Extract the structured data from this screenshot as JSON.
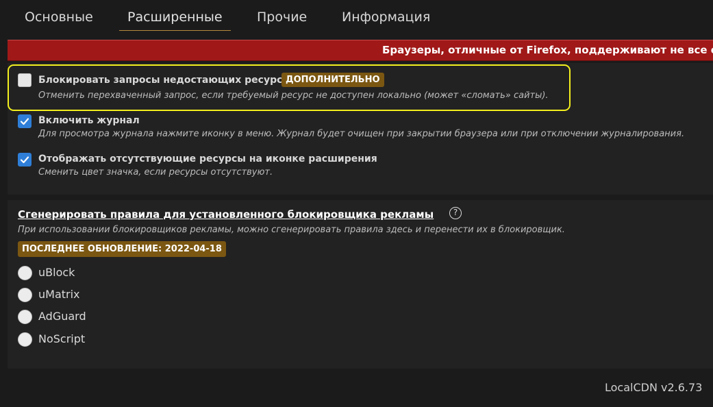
{
  "tabs": [
    {
      "label": "Основные"
    },
    {
      "label": "Расширенные",
      "active": true
    },
    {
      "label": "Прочие"
    },
    {
      "label": "Информация"
    }
  ],
  "banner": {
    "text": "Браузеры, отличные от Firefox, поддерживают не все о",
    "color": "#a01818"
  },
  "options": [
    {
      "title": "Блокировать запросы недостающих ресурсов",
      "badge": "ДОПОЛНИТЕЛЬНО",
      "description": "Отменить перехваченный запрос, если требуемый ресурс не доступен локально (может «сломать» сайты).",
      "checked": false
    },
    {
      "title": "Включить журнал",
      "description": "Для просмотра журнала нажмите иконку в меню. Журнал будет очищен при закрытии браузера или при отключении журналирования.",
      "checked": true
    },
    {
      "title": "Отображать отсутствующие ресурсы на иконке расширения",
      "description": "Сменить цвет значка, если ресурсы отсутствуют.",
      "checked": true
    }
  ],
  "rules": {
    "title": "Сгенерировать правила для установленного блокировщика рекламы",
    "help_icon": "?",
    "description": "При использовании блокировщиков рекламы, можно сгенерировать правила здесь и перенести их в блокировщик.",
    "last_update": "ПОСЛЕДНЕЕ ОБНОВЛЕНИЕ: 2022-04-18",
    "blockers": [
      {
        "label": "uBlock",
        "selected": false
      },
      {
        "label": "uMatrix",
        "selected": false
      },
      {
        "label": "AdGuard",
        "selected": false
      },
      {
        "label": "NoScript",
        "selected": false
      }
    ]
  },
  "footer": {
    "version": "LocalCDN v2.6.73"
  },
  "colors": {
    "accent": "#2f7fd8",
    "badge": "#7b5712",
    "highlight": "#f2ef1e"
  }
}
